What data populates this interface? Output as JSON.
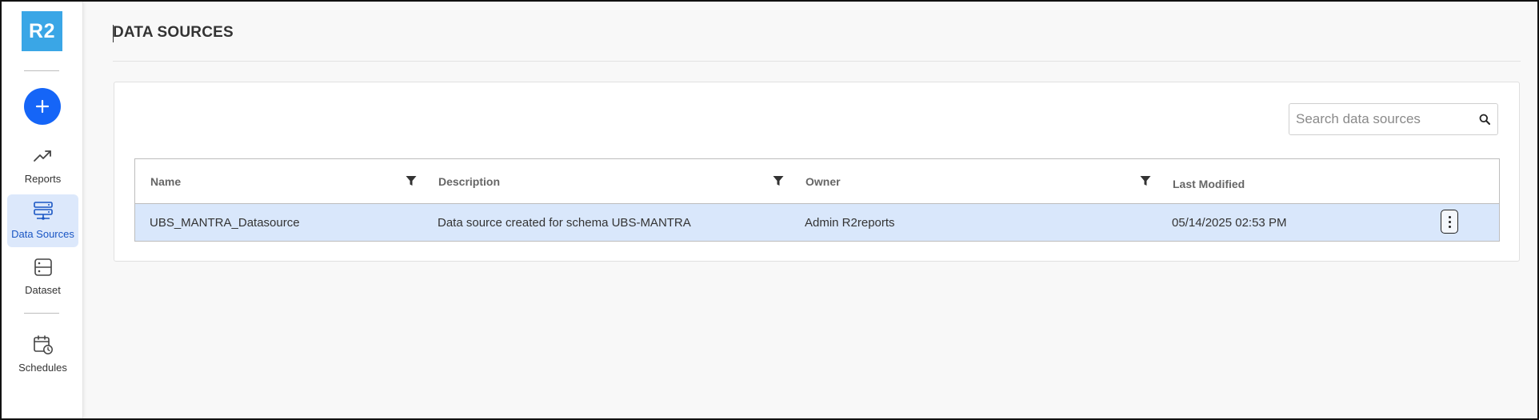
{
  "sidebar": {
    "logo_text": "R2",
    "add_icon": "plus-icon",
    "items": [
      {
        "label": "Reports",
        "icon": "trending-up-icon",
        "active": false
      },
      {
        "label": "Data Sources",
        "icon": "server-icon",
        "active": true
      },
      {
        "label": "Dataset",
        "icon": "dataset-icon",
        "active": false
      },
      {
        "label": "Schedules",
        "icon": "calendar-clock-icon",
        "active": false
      }
    ]
  },
  "page": {
    "title": "DATA SOURCES"
  },
  "search": {
    "placeholder": "Search data sources",
    "value": "",
    "icon": "search-icon"
  },
  "table": {
    "columns": [
      {
        "label": "Name",
        "filterable": true
      },
      {
        "label": "Description",
        "filterable": true
      },
      {
        "label": "Owner",
        "filterable": true
      },
      {
        "label": "Last Modified",
        "filterable": false
      }
    ],
    "rows": [
      {
        "name": "UBS_MANTRA_Datasource",
        "description": "Data source created for schema UBS-MANTRA",
        "owner": "Admin R2reports",
        "last_modified": "05/14/2025 02:53 PM",
        "selected": true
      }
    ]
  },
  "colors": {
    "accent": "#1565f7",
    "logo": "#3aa6e6",
    "active_nav_bg": "#dce8fb",
    "selected_row_bg": "#d9e7fb"
  }
}
